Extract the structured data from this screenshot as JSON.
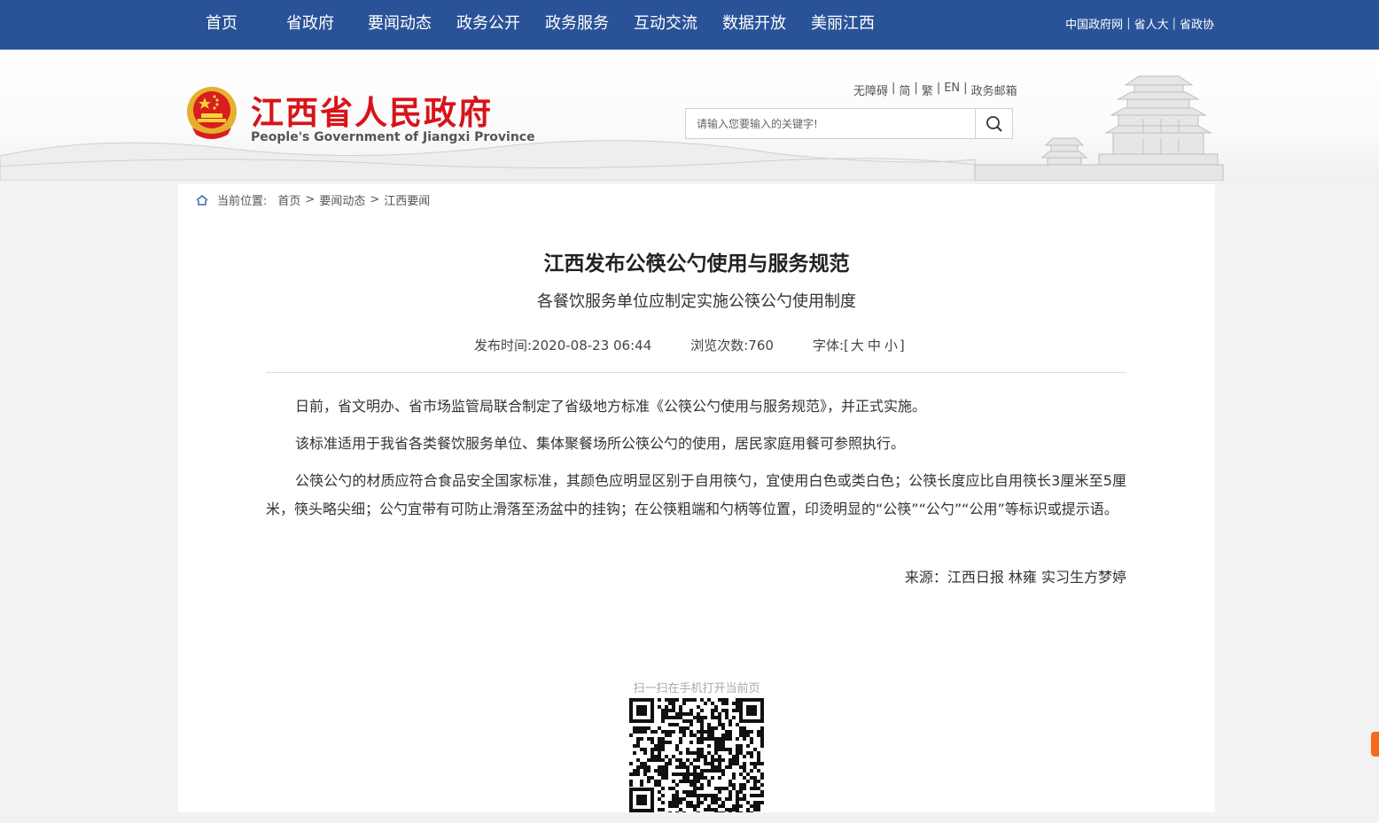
{
  "top_nav": {
    "items": [
      "首页",
      "省政府",
      "要闻动态",
      "政务公开",
      "政务服务",
      "互动交流",
      "数据开放",
      "美丽江西"
    ]
  },
  "top_links": [
    "中国政府网",
    "省人大",
    "省政协"
  ],
  "header": {
    "title": "江西省人民政府",
    "subtitle": "People's Government of Jiangxi Province",
    "util_links": [
      "无障碍",
      "简",
      "繁",
      "EN",
      "政务邮箱"
    ],
    "search_placeholder": "请输入您要输入的关键字!",
    "emblem_icon": "national-emblem-icon",
    "search_icon": "search-icon"
  },
  "breadcrumb": {
    "prefix": "当前位置:",
    "items": [
      "首页",
      "要闻动态",
      "江西要闻"
    ],
    "home_icon": "home-icon"
  },
  "article": {
    "title": "江西发布公筷公勺使用与服务规范",
    "subtitle": "各餐饮服务单位应制定实施公筷公勺使用制度",
    "publish_label": "发布时间:",
    "publish_time": "2020-08-23 06:44",
    "views_label": "浏览次数:",
    "views": "760",
    "font_label": "字体:",
    "font_sizes": [
      "大",
      "中",
      "小"
    ],
    "paragraphs": [
      "日前，省文明办、省市场监管局联合制定了省级地方标准《公筷公勺使用与服务规范》，并正式实施。",
      "该标准适用于我省各类餐饮服务单位、集体聚餐场所公筷公勺的使用，居民家庭用餐可参照执行。",
      "公筷公勺的材质应符合食品安全国家标准，其颜色应明显区别于自用筷勺，宜使用白色或类白色；公筷长度应比自用筷长3厘米至5厘米，筷头略尖细；公勺宜带有可防止滑落至汤盆中的挂钩；在公筷粗端和勺柄等位置，印烫明显的“公筷”“公勺”“公用”等标识或提示语。"
    ],
    "source": "来源：江西日报 林雍 实习生方梦婷"
  },
  "qr": {
    "tip": "扫一扫在手机打开当前页"
  },
  "colors": {
    "nav_bg": "#2a5397",
    "title_red": "#d7141a",
    "side_tab": "#f56a1b"
  }
}
